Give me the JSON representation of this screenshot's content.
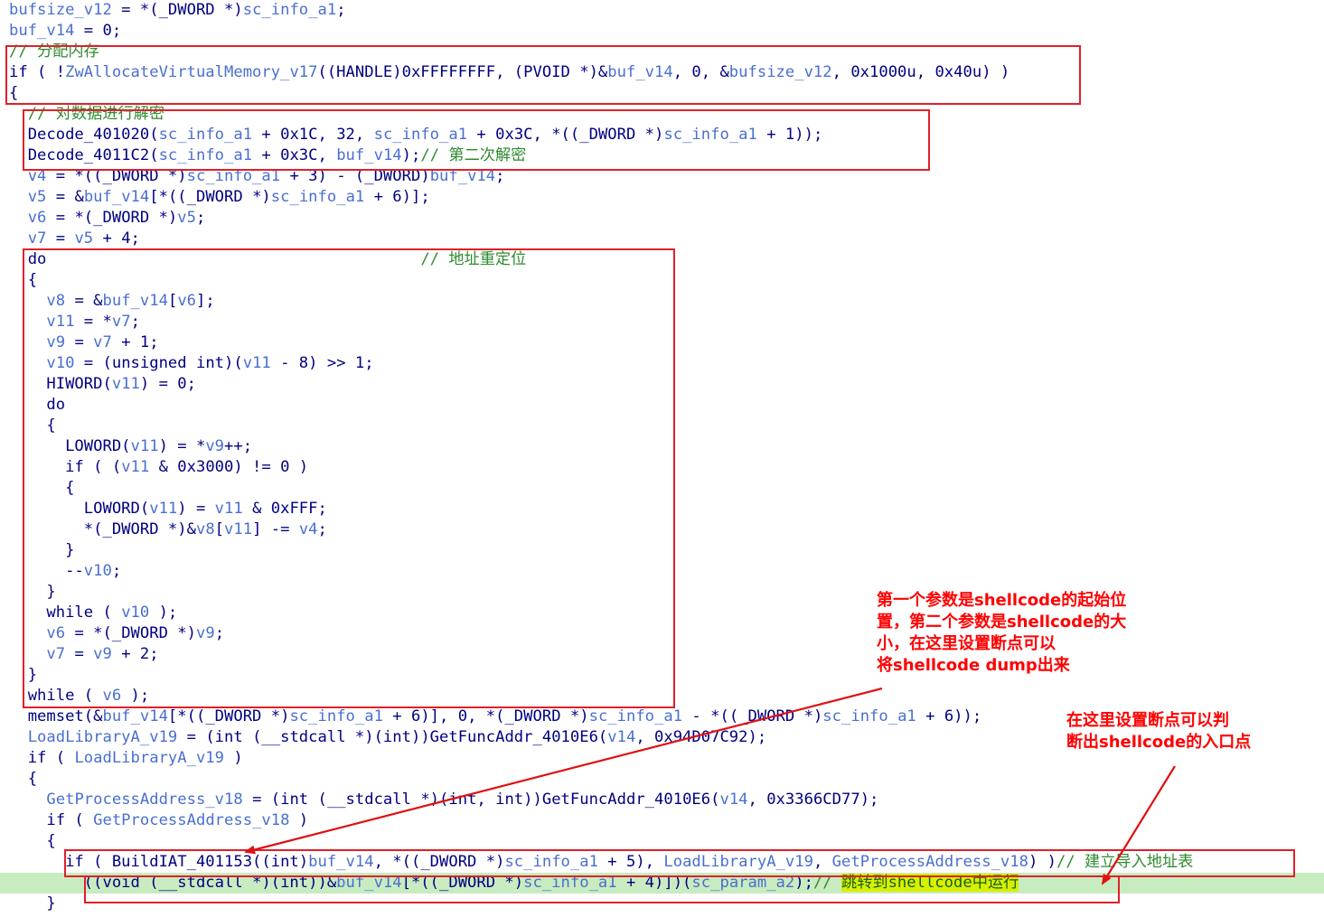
{
  "code_lines": [
    {
      "segs": [
        [
          "v",
          "bufsize_v12"
        ],
        [
          "t",
          " = *(_DWORD *)"
        ],
        [
          "v",
          "sc_info_a1"
        ],
        [
          "t",
          ";"
        ]
      ]
    },
    {
      "segs": [
        [
          "v",
          "buf_v14"
        ],
        [
          "t",
          " = 0;"
        ]
      ]
    },
    {
      "segs": [
        [
          "c",
          "// 分配内存"
        ]
      ]
    },
    {
      "segs": [
        [
          "t",
          "if ( !"
        ],
        [
          "v",
          "ZwAllocateVirtualMemory_v17"
        ],
        [
          "t",
          "((HANDLE)0xFFFFFFFF, (PVOID *)&"
        ],
        [
          "v",
          "buf_v14"
        ],
        [
          "t",
          ", 0, &"
        ],
        [
          "v",
          "bufsize_v12"
        ],
        [
          "t",
          ", 0x1000u, 0x40u) )"
        ]
      ]
    },
    {
      "segs": [
        [
          "t",
          "{"
        ]
      ]
    },
    {
      "segs": [
        [
          "t",
          "  "
        ],
        [
          "c",
          "// 对数据进行解密"
        ]
      ]
    },
    {
      "segs": [
        [
          "t",
          "  Decode_401020("
        ],
        [
          "v",
          "sc_info_a1"
        ],
        [
          "t",
          " + 0x1C, 32, "
        ],
        [
          "v",
          "sc_info_a1"
        ],
        [
          "t",
          " + 0x3C, *((_DWORD *)"
        ],
        [
          "v",
          "sc_info_a1"
        ],
        [
          "t",
          " + 1));"
        ]
      ]
    },
    {
      "segs": [
        [
          "t",
          "  Decode_4011C2("
        ],
        [
          "v",
          "sc_info_a1"
        ],
        [
          "t",
          " + 0x3C, "
        ],
        [
          "v",
          "buf_v14"
        ],
        [
          "t",
          ");"
        ],
        [
          "c",
          "// 第二次解密"
        ]
      ]
    },
    {
      "segs": [
        [
          "t",
          "  "
        ],
        [
          "v",
          "v4"
        ],
        [
          "t",
          " = *((_DWORD *)"
        ],
        [
          "v",
          "sc_info_a1"
        ],
        [
          "t",
          " + 3) - (_DWORD)"
        ],
        [
          "v",
          "buf_v14"
        ],
        [
          "t",
          ";"
        ]
      ]
    },
    {
      "segs": [
        [
          "t",
          "  "
        ],
        [
          "v",
          "v5"
        ],
        [
          "t",
          " = &"
        ],
        [
          "v",
          "buf_v14"
        ],
        [
          "t",
          "[*((_DWORD *)"
        ],
        [
          "v",
          "sc_info_a1"
        ],
        [
          "t",
          " + 6)];"
        ]
      ]
    },
    {
      "segs": [
        [
          "t",
          "  "
        ],
        [
          "v",
          "v6"
        ],
        [
          "t",
          " = *(_DWORD *)"
        ],
        [
          "v",
          "v5"
        ],
        [
          "t",
          ";"
        ]
      ]
    },
    {
      "segs": [
        [
          "t",
          "  "
        ],
        [
          "v",
          "v7"
        ],
        [
          "t",
          " = "
        ],
        [
          "v",
          "v5"
        ],
        [
          "t",
          " + 4;"
        ]
      ]
    },
    {
      "segs": [
        [
          "t",
          "  do                                        "
        ],
        [
          "c",
          "// 地址重定位"
        ]
      ]
    },
    {
      "segs": [
        [
          "t",
          "  {"
        ]
      ]
    },
    {
      "segs": [
        [
          "t",
          "    "
        ],
        [
          "v",
          "v8"
        ],
        [
          "t",
          " = &"
        ],
        [
          "v",
          "buf_v14"
        ],
        [
          "t",
          "["
        ],
        [
          "v",
          "v6"
        ],
        [
          "t",
          "];"
        ]
      ]
    },
    {
      "segs": [
        [
          "t",
          "    "
        ],
        [
          "v",
          "v11"
        ],
        [
          "t",
          " = *"
        ],
        [
          "v",
          "v7"
        ],
        [
          "t",
          ";"
        ]
      ]
    },
    {
      "segs": [
        [
          "t",
          "    "
        ],
        [
          "v",
          "v9"
        ],
        [
          "t",
          " = "
        ],
        [
          "v",
          "v7"
        ],
        [
          "t",
          " + 1;"
        ]
      ]
    },
    {
      "segs": [
        [
          "t",
          "    "
        ],
        [
          "v",
          "v10"
        ],
        [
          "t",
          " = (unsigned int)("
        ],
        [
          "v",
          "v11"
        ],
        [
          "t",
          " - 8) >> 1;"
        ]
      ]
    },
    {
      "segs": [
        [
          "t",
          "    HIWORD("
        ],
        [
          "v",
          "v11"
        ],
        [
          "t",
          ") = 0;"
        ]
      ]
    },
    {
      "segs": [
        [
          "t",
          "    do"
        ]
      ]
    },
    {
      "segs": [
        [
          "t",
          "    {"
        ]
      ]
    },
    {
      "segs": [
        [
          "t",
          "      LOWORD("
        ],
        [
          "v",
          "v11"
        ],
        [
          "t",
          ") = *"
        ],
        [
          "v",
          "v9"
        ],
        [
          "t",
          "++;"
        ]
      ]
    },
    {
      "segs": [
        [
          "t",
          "      if ( ("
        ],
        [
          "v",
          "v11"
        ],
        [
          "t",
          " & 0x3000) != 0 )"
        ]
      ]
    },
    {
      "segs": [
        [
          "t",
          "      {"
        ]
      ]
    },
    {
      "segs": [
        [
          "t",
          "        LOWORD("
        ],
        [
          "v",
          "v11"
        ],
        [
          "t",
          ") = "
        ],
        [
          "v",
          "v11"
        ],
        [
          "t",
          " & 0xFFF;"
        ]
      ]
    },
    {
      "segs": [
        [
          "t",
          "        *(_DWORD *)&"
        ],
        [
          "v",
          "v8"
        ],
        [
          "t",
          "["
        ],
        [
          "v",
          "v11"
        ],
        [
          "t",
          "] -= "
        ],
        [
          "v",
          "v4"
        ],
        [
          "t",
          ";"
        ]
      ]
    },
    {
      "segs": [
        [
          "t",
          "      }"
        ]
      ]
    },
    {
      "segs": [
        [
          "t",
          "      --"
        ],
        [
          "v",
          "v10"
        ],
        [
          "t",
          ";"
        ]
      ]
    },
    {
      "segs": [
        [
          "t",
          "    }"
        ]
      ]
    },
    {
      "segs": [
        [
          "t",
          "    while ( "
        ],
        [
          "v",
          "v10"
        ],
        [
          "t",
          " );"
        ]
      ]
    },
    {
      "segs": [
        [
          "t",
          "    "
        ],
        [
          "v",
          "v6"
        ],
        [
          "t",
          " = *(_DWORD *)"
        ],
        [
          "v",
          "v9"
        ],
        [
          "t",
          ";"
        ]
      ]
    },
    {
      "segs": [
        [
          "t",
          "    "
        ],
        [
          "v",
          "v7"
        ],
        [
          "t",
          " = "
        ],
        [
          "v",
          "v9"
        ],
        [
          "t",
          " + 2;"
        ]
      ]
    },
    {
      "segs": [
        [
          "t",
          "  }"
        ]
      ]
    },
    {
      "segs": [
        [
          "t",
          "  while ( "
        ],
        [
          "v",
          "v6"
        ],
        [
          "t",
          " );"
        ]
      ]
    },
    {
      "segs": [
        [
          "t",
          "  memset(&"
        ],
        [
          "v",
          "buf_v14"
        ],
        [
          "t",
          "[*((_DWORD *)"
        ],
        [
          "v",
          "sc_info_a1"
        ],
        [
          "t",
          " + 6)], 0, *(_DWORD *)"
        ],
        [
          "v",
          "sc_info_a1"
        ],
        [
          "t",
          " - *((_DWORD *)"
        ],
        [
          "v",
          "sc_info_a1"
        ],
        [
          "t",
          " + 6));"
        ]
      ]
    },
    {
      "segs": [
        [
          "t",
          "  "
        ],
        [
          "v",
          "LoadLibraryA_v19"
        ],
        [
          "t",
          " = (int (__stdcall *)(int))GetFuncAddr_4010E6("
        ],
        [
          "v",
          "v14"
        ],
        [
          "t",
          ", 0x94D07C92);"
        ]
      ]
    },
    {
      "segs": [
        [
          "t",
          "  if ( "
        ],
        [
          "v",
          "LoadLibraryA_v19"
        ],
        [
          "t",
          " )"
        ]
      ]
    },
    {
      "segs": [
        [
          "t",
          "  {"
        ]
      ]
    },
    {
      "segs": [
        [
          "t",
          "    "
        ],
        [
          "v",
          "GetProcessAddress_v18"
        ],
        [
          "t",
          " = (int (__stdcall *)(int, int))GetFuncAddr_4010E6("
        ],
        [
          "v",
          "v14"
        ],
        [
          "t",
          ", 0x3366CD77);"
        ]
      ]
    },
    {
      "segs": [
        [
          "t",
          "    if ( "
        ],
        [
          "v",
          "GetProcessAddress_v18"
        ],
        [
          "t",
          " )"
        ]
      ]
    },
    {
      "segs": [
        [
          "t",
          "    {"
        ]
      ]
    },
    {
      "segs": [
        [
          "t",
          "      if ( BuildIAT_401153((int)"
        ],
        [
          "v",
          "buf_v14"
        ],
        [
          "t",
          ", *((_DWORD *)"
        ],
        [
          "v",
          "sc_info_a1"
        ],
        [
          "t",
          " + 5), "
        ],
        [
          "v",
          "LoadLibraryA_v19"
        ],
        [
          "t",
          ", "
        ],
        [
          "v",
          "GetProcessAddress_v18"
        ],
        [
          "t",
          ") )"
        ],
        [
          "c",
          "// 建立导入地址表"
        ]
      ]
    },
    {
      "segs": [
        [
          "t",
          "        ((void (__stdcall *)(int))&"
        ],
        [
          "v",
          "buf_v14"
        ],
        [
          "t",
          "[*((_DWORD *)"
        ],
        [
          "v",
          "sc_info_a1"
        ],
        [
          "t",
          " + 4)])("
        ],
        [
          "v",
          "sc_param_a2"
        ],
        [
          "t",
          ");"
        ],
        [
          "c",
          "// "
        ],
        [
          "h",
          "跳转到shellcode中运行"
        ]
      ],
      "highlight": true
    },
    {
      "segs": [
        [
          "t",
          "    }"
        ]
      ]
    }
  ],
  "annotations": {
    "note1": "第一个参数是shellcode的起始位\n置，第二个参数是shellcode的大\n小，在这里设置断点可以\n将shellcode dump出来",
    "note2": "在这里设置断点可以判\n断出shellcode的入口点"
  },
  "colors": {
    "box_border": "#e0202a",
    "annotation_text": "#ff0000",
    "highlight_line": "#c8ecc0",
    "highlight_text": "#d7f000"
  }
}
